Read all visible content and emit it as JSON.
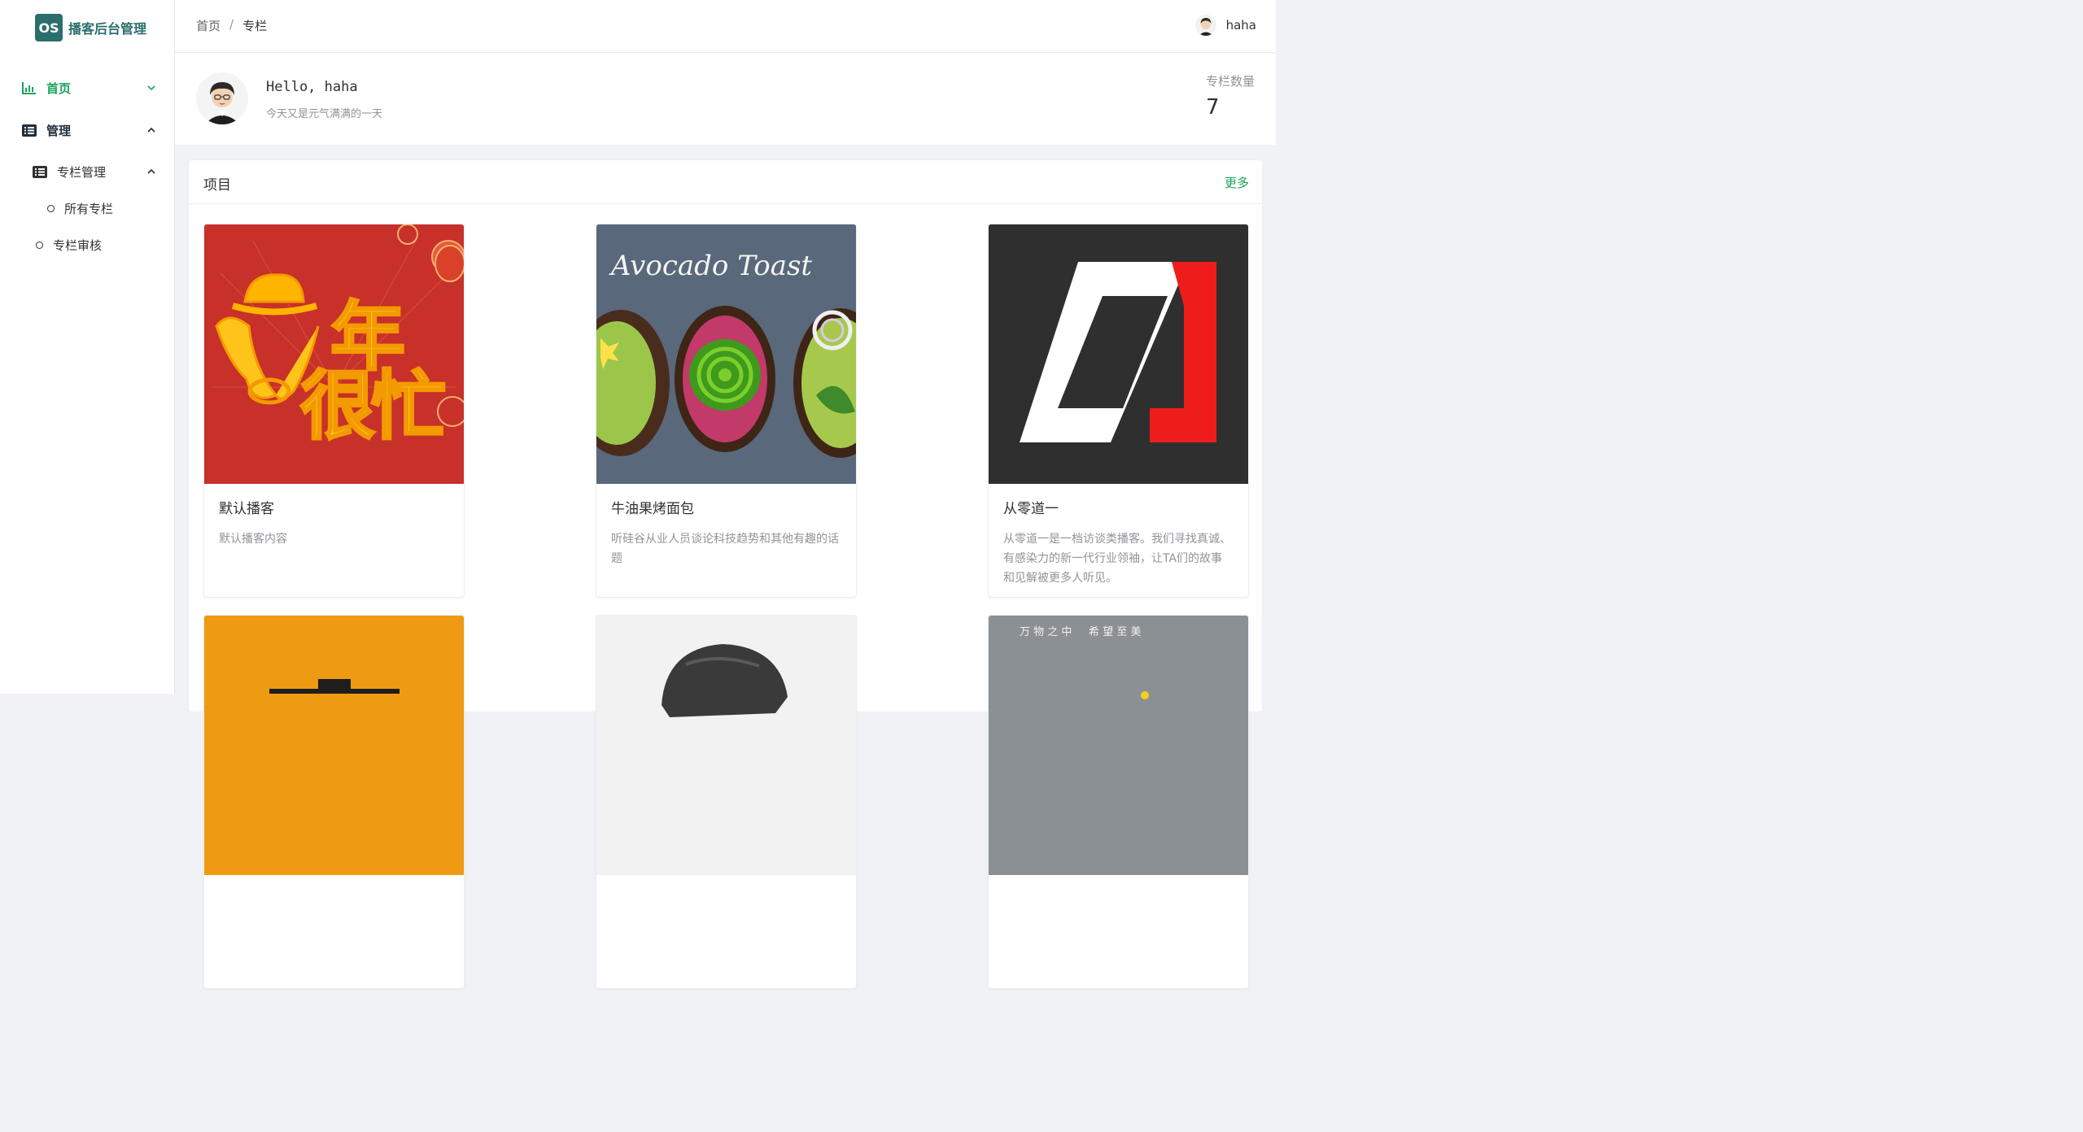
{
  "logo": {
    "mark": "OS",
    "title": "播客后台管理"
  },
  "sidebar": {
    "items": [
      {
        "label": "首页",
        "icon": "bar-chart-icon"
      },
      {
        "label": "管理",
        "icon": "list-icon"
      },
      {
        "label": "专栏管理",
        "icon": "list-icon"
      },
      {
        "label": "所有专栏",
        "icon": "circle-icon"
      },
      {
        "label": "专栏审核",
        "icon": "circle-icon"
      }
    ]
  },
  "header": {
    "breadcrumb": [
      "首页",
      "专栏"
    ],
    "separator": "/",
    "username": "haha"
  },
  "welcome": {
    "greeting": "Hello, haha",
    "subtitle": "今天又是元气满满的一天",
    "stat_label": "专栏数量",
    "stat_value": "7"
  },
  "projects": {
    "title": "项目",
    "more": "更多",
    "cards": [
      {
        "title": "默认播客",
        "desc": "默认播客内容",
        "image": "new-year-ox-cover"
      },
      {
        "title": "牛油果烤面包",
        "desc": "听硅谷从业人员谈论科技趋势和其他有趣的话题",
        "image": "avocado-toast-cover",
        "image_text": "Avocado Toast"
      },
      {
        "title": "从零道一",
        "desc": "从零道一是一档访谈类播客。我们寻找真诚、有感染力的新一代行业领袖，让TA们的故事和见解被更多人听见。",
        "image": "zero-to-one-logo-cover"
      },
      {
        "title": "",
        "desc": "",
        "image": "orange-cover"
      },
      {
        "title": "",
        "desc": "",
        "image": "cartoon-head-cover"
      },
      {
        "title": "",
        "desc": "",
        "image": "grey-landscape-cover",
        "image_text": "万 物 之 中     希 望 至 美"
      }
    ]
  },
  "colors": {
    "accent": "#1aa35b",
    "brand": "#2a6f6c",
    "red_cover": "#c8302a",
    "orange_cover": "#ef9a13"
  }
}
